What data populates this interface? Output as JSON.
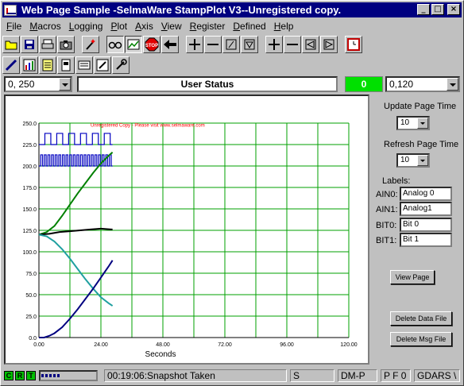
{
  "window": {
    "title": "Web Page Sample -SelmaWare StampPlot V3--Unregistered copy.",
    "controls": {
      "minimize": "_",
      "maximize": "□",
      "close": "×"
    }
  },
  "menu": [
    {
      "label": "File",
      "hotkey": "F",
      "rest": "ile"
    },
    {
      "label": "Macros",
      "hotkey": "M",
      "rest": "acros"
    },
    {
      "label": "Logging",
      "hotkey": "L",
      "rest": "ogging"
    },
    {
      "label": "Plot",
      "hotkey": "P",
      "rest": "lot"
    },
    {
      "label": "Axis",
      "hotkey": "A",
      "rest": "xis"
    },
    {
      "label": "View",
      "hotkey": "V",
      "rest": "iew"
    },
    {
      "label": "Register",
      "hotkey": "R",
      "rest": "egister"
    },
    {
      "label": "Defined",
      "hotkey": "D",
      "rest": "efined"
    },
    {
      "label": "Help",
      "hotkey": "H",
      "rest": "elp"
    }
  ],
  "toolbar": {
    "stop_label": "STOP",
    "icons": [
      "open-folder-icon",
      "save-icon",
      "print-icon",
      "camera-icon",
      "wand-icon",
      "spectacles-icon",
      "chart-icon",
      "stop-icon",
      "arrow-left-icon",
      "plus-icon",
      "minus-icon",
      "slash-box-icon",
      "down-triangle-icon",
      "plus-icon",
      "minus-icon",
      "left-triangle-icon",
      "right-triangle-icon",
      "clock-icon"
    ]
  },
  "status_row": {
    "left_combo": "0, 250",
    "user_status": "User Status",
    "green_value": "0",
    "right_combo": "0,120"
  },
  "chart_data": {
    "type": "line",
    "watermark": "Unregistered Copy - Please visit www.selmaware.com",
    "xlabel": "Seconds",
    "ylabel": "",
    "xlim": [
      0,
      120
    ],
    "ylim": [
      0,
      250
    ],
    "xticks": [
      "0.00",
      "24.00",
      "48.00",
      "72.00",
      "96.00",
      "120.00"
    ],
    "yticks": [
      "0.0",
      "25.0",
      "50.0",
      "75.0",
      "100.0",
      "125.0",
      "150.0",
      "175.0",
      "200.0",
      "225.0",
      "250.0"
    ],
    "grid": true,
    "colors": {
      "grid": "#00a000",
      "axes": "#000000",
      "watermark": "#ff0000"
    },
    "series": [
      {
        "color": "#008000",
        "x": [
          0,
          3,
          6,
          9,
          12,
          15,
          18,
          21,
          24,
          27,
          28.5
        ],
        "y": [
          120,
          123,
          130,
          142,
          155,
          168,
          180,
          192,
          203,
          212,
          216
        ]
      },
      {
        "color": "#000000",
        "x": [
          0,
          4,
          8,
          12,
          16,
          20,
          24,
          28,
          28.5
        ],
        "y": [
          120,
          121,
          123,
          124,
          125,
          126,
          127,
          126,
          126
        ]
      },
      {
        "color": "#20a0a0",
        "x": [
          0,
          3,
          6,
          9,
          12,
          15,
          18,
          21,
          24,
          27,
          28.5
        ],
        "y": [
          120,
          118,
          112,
          103,
          92,
          80,
          68,
          57,
          47,
          40,
          37
        ]
      },
      {
        "color": "#000080",
        "x": [
          0,
          2,
          4,
          6,
          9,
          12,
          15,
          18,
          21,
          24,
          27,
          28.5
        ],
        "y": [
          0,
          0,
          2,
          5,
          12,
          22,
          33,
          45,
          57,
          70,
          83,
          90
        ]
      }
    ],
    "digital": [
      {
        "color": "#0000c0",
        "low": 225,
        "high": 238,
        "period": 4.6,
        "start": 1
      },
      {
        "color": "#0000c0",
        "low": 200,
        "high": 213,
        "period": 1.4,
        "start": 1
      }
    ]
  },
  "right_panel": {
    "update_label": "Update Page Time",
    "update_value": "10",
    "refresh_label": "Refresh Page Time",
    "refresh_value": "10",
    "labels_title": "Labels:",
    "fields": [
      {
        "label": "AIN0:",
        "value": "Analog 0"
      },
      {
        "label": "AIN1:",
        "value": "Analog1"
      },
      {
        "label": "BIT0:",
        "value": "Bit 0"
      },
      {
        "label": "BIT1:",
        "value": "Bit 1"
      }
    ],
    "view_page": "View Page",
    "delete_data": "Delete Data File",
    "delete_msg": "Delete Msg File"
  },
  "statusbar": {
    "c": "C",
    "r": "R",
    "t": "T",
    "progress": 0.35,
    "message": "00:19:06:Snapshot Taken",
    "s": "S",
    "dmp": "DM-P",
    "pf": "P F 0",
    "gdars": "GDARS \\"
  }
}
